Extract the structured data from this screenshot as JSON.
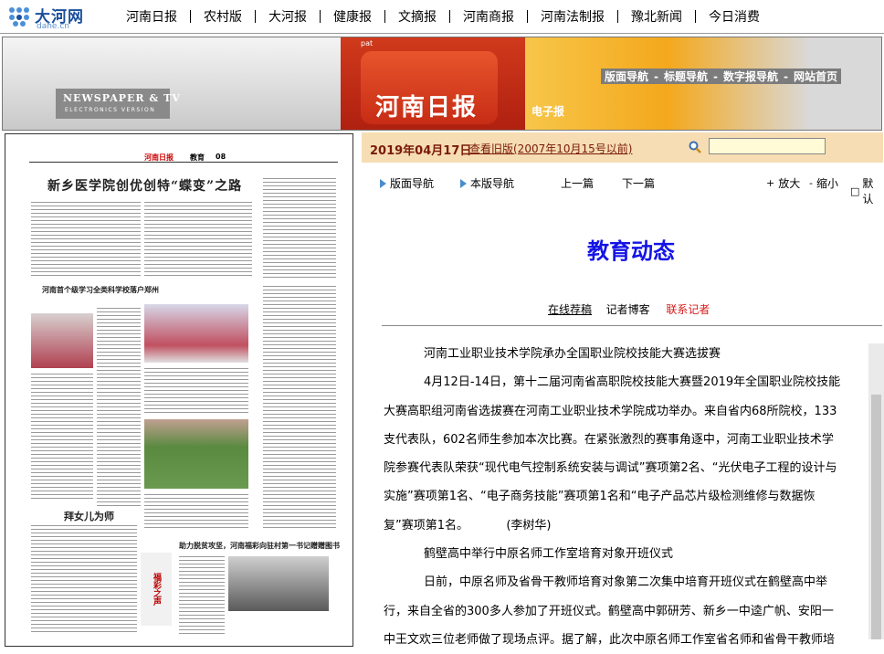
{
  "site": {
    "logo_text": "大河网",
    "logo_sub": "dahe.cn"
  },
  "top_nav": [
    "河南日报",
    "农村版",
    "大河报",
    "健康报",
    "文摘报",
    "河南商报",
    "河南法制报",
    "豫北新闻",
    "今日消费"
  ],
  "banner": {
    "newspaper_tv": "NEWSPAPER & TV",
    "electronics_version": "ELECTRONICS VERSION",
    "pat": "pat",
    "title": "河南日报",
    "electronic": "电子报",
    "links": [
      "版面导航",
      "标题导航",
      "数字报导航",
      "网站首页"
    ]
  },
  "newspaper_page": {
    "masthead": "河南日报",
    "section": "教育",
    "page_no": "08",
    "headline": "新乡医学院创优创特“蝶变”之路",
    "subhead_1": "河南首个级学习全类科学校落户郑州",
    "feature_head": "拜女儿为师",
    "ad_head": "助力脱贫攻坚，河南福彩向驻村第一书记赠赠图书",
    "ad_logo": "福彩之声"
  },
  "date_bar": {
    "date": "2019年04月17日",
    "archive_link": "查看旧版(2007年10月15号以前)",
    "search_placeholder": ""
  },
  "nav_row": {
    "layout_nav": "版面导航",
    "this_page_nav": "本版导航",
    "prev": "上一篇",
    "next": "下一篇",
    "zoom_in": "放大",
    "zoom_out": "缩小",
    "default": "默认"
  },
  "section_title": "教育动态",
  "links": {
    "submit": "在线荐稿",
    "blog": "记者博客",
    "contact": "联系记者"
  },
  "article": [
    "河南工业职业技术学院承办全国职业院校技能大赛选拔赛",
    "4月12日-14日，第十二届河南省高职院校技能大赛暨2019年全国职业院校技能",
    "大赛高职组河南省选拔赛在河南工业职业技术学院成功举办。来自省内68所院校，133",
    "支代表队，602名师生参加本次比赛。在紧张激烈的赛事角逐中，河南工业职业技术学",
    "院参赛代表队荣获“现代电气控制系统安装与调试”赛项第2名、“光伏电子工程的设计与",
    "实施”赛项第1名、“电子商务技能”赛项第1名和“电子产品芯片级检测维修与数据恢",
    "复”赛项第1名。          (李树华)",
    "鹤壁高中举行中原名师工作室培育对象开班仪式",
    "日前，中原名师及省骨干教师培育对象第二次集中培育开班仪式在鹤壁高中举",
    "行，来自全省的300多人参加了开班仪式。鹤壁高中郭研芳、新乡一中逵广帆、安阳一",
    "中王文欢三位老师做了现场点评。据了解，此次中原名师工作室省名师和省骨干教师培"
  ]
}
